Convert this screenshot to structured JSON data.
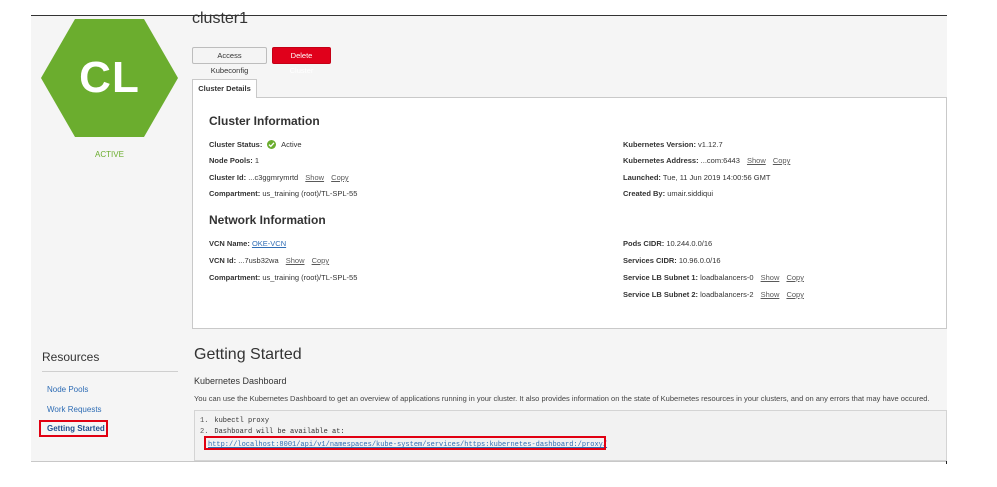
{
  "cluster": {
    "title": "cluster1",
    "initials": "CL",
    "state": "ACTIVE",
    "hex_color": "#6bad2e"
  },
  "actions": {
    "access_kubeconfig": "Access Kubeconfig",
    "delete_cluster": "Delete Cluster"
  },
  "tabs": [
    "Cluster Details"
  ],
  "cluster_info": {
    "title": "Cluster Information",
    "status_label": "Cluster Status:",
    "status_value": "Active",
    "node_pools_label": "Node Pools:",
    "node_pools_value": "1",
    "cluster_id_label": "Cluster Id:",
    "cluster_id_value": "...c3ggmrymrtd",
    "compartment_label": "Compartment:",
    "compartment_value": "us_training (root)/TL-SPL-55",
    "k8s_version_label": "Kubernetes Version:",
    "k8s_version_value": "v1.12.7",
    "k8s_address_label": "Kubernetes Address:",
    "k8s_address_value": "...com:6443",
    "launched_label": "Launched:",
    "launched_value": "Tue, 11 Jun 2019 14:00:56 GMT",
    "created_by_label": "Created By:",
    "created_by_value": "umair.siddiqui"
  },
  "network_info": {
    "title": "Network Information",
    "vcn_name_label": "VCN Name:",
    "vcn_name_value": "OKE-VCN",
    "vcn_id_label": "VCN Id:",
    "vcn_id_value": "...7usb32wa",
    "compartment_label": "Compartment:",
    "compartment_value": "us_training (root)/TL-SPL-55",
    "pods_cidr_label": "Pods CIDR:",
    "pods_cidr_value": "10.244.0.0/16",
    "services_cidr_label": "Services CIDR:",
    "services_cidr_value": "10.96.0.0/16",
    "lb_subnet1_label": "Service LB Subnet 1:",
    "lb_subnet1_value": "loadbalancers-0",
    "lb_subnet2_label": "Service LB Subnet 2:",
    "lb_subnet2_value": "loadbalancers-2"
  },
  "link_labels": {
    "show": "Show",
    "copy": "Copy"
  },
  "resources": {
    "title": "Resources",
    "items": [
      "Node Pools",
      "Work Requests",
      "Getting Started"
    ],
    "selected": "Getting Started"
  },
  "getting_started": {
    "title": "Getting Started",
    "subtitle": "Kubernetes Dashboard",
    "description": "You can use the Kubernetes Dashboard to get an overview of applications running in your cluster. It also provides information on the state of Kubernetes resources in your clusters, and on any errors that may have occured.",
    "steps": [
      {
        "num": "1.",
        "text": "kubectl proxy"
      },
      {
        "num": "2.",
        "text": "Dashboard will be available at:"
      }
    ],
    "dashboard_url": "http://localhost:8001/api/v1/namespaces/kube-system/services/https:kubernetes-dashboard:/proxy/"
  },
  "colors": {
    "accent_green": "#6bad2e",
    "danger_red": "#e0001b",
    "link_blue": "#2f6db5",
    "highlight_red": "#e10012"
  }
}
